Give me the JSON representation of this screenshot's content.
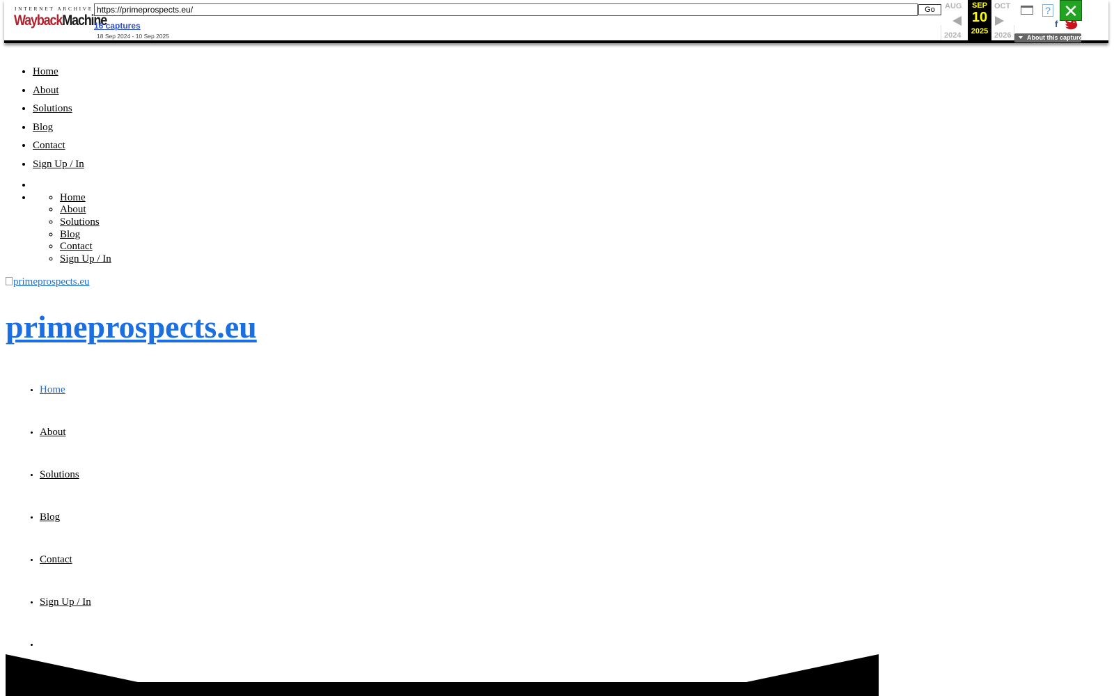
{
  "wayback": {
    "logo_top": "INTERNET ARCHIVE",
    "logo_main_red": "Wayback",
    "logo_main_black": "Machine",
    "url": "https://primeprospects.eu/",
    "go_label": "Go",
    "captures_label": "16 captures",
    "capture_range": "18 Sep 2024 - 10 Sep 2025",
    "prev_month": "AUG",
    "current_month": "SEP",
    "next_month": "OCT",
    "current_day": "10",
    "prev_year": "2024",
    "current_year": "2025",
    "next_year": "2026",
    "about_label": "About this capture",
    "help_glyph": "?",
    "close_glyph": "✕",
    "facebook_glyph": "f",
    "colors": {
      "current_bg": "#000000",
      "current_text": "#ffff00",
      "close_bg": "#22a321"
    }
  },
  "nav_primary": {
    "items": [
      "Home",
      "About",
      "Solutions",
      "Blog",
      "Contact",
      "Sign Up / In"
    ]
  },
  "nav_mobile": {
    "items": [
      "Home",
      "About",
      "Solutions",
      "Blog",
      "Contact",
      "Sign Up / In"
    ]
  },
  "hero": {
    "image_alt": "primeprospects.eu",
    "site_title": "primeprospects.eu"
  },
  "nav_main": {
    "items": [
      "Home",
      "About",
      "Solutions",
      "Blog",
      "Contact",
      "Sign Up / In"
    ],
    "active": "Home",
    "link_color": "#1e6fd0"
  }
}
